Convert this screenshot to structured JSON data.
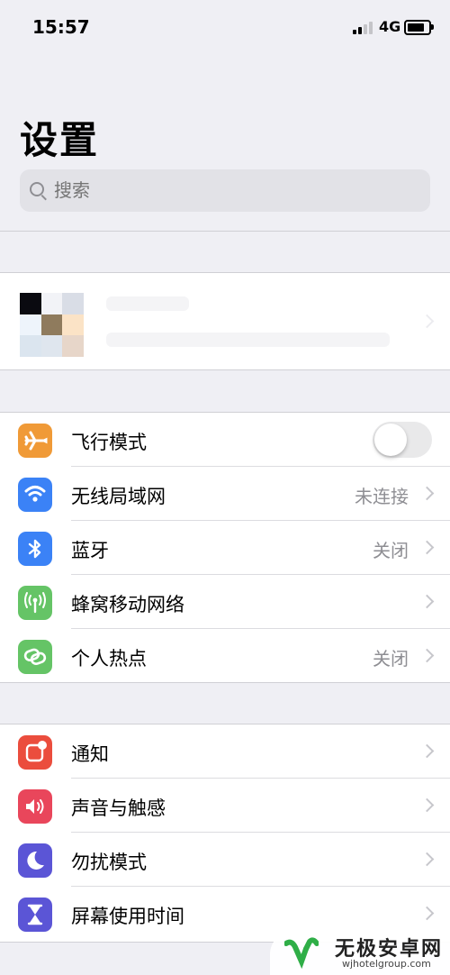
{
  "status_bar": {
    "time": "15:57",
    "network": "4G",
    "battery_level": 0.8
  },
  "page": {
    "title": "设置"
  },
  "search": {
    "placeholder": "搜索"
  },
  "profile": {
    "name": "",
    "subtitle": ""
  },
  "connectivity": [
    {
      "label": "飞行模式",
      "icon": "airplane-icon",
      "color": "#f09a37",
      "toggle": false
    },
    {
      "label": "无线局域网",
      "icon": "wifi-icon",
      "color": "#3b82f6",
      "value": "未连接"
    },
    {
      "label": "蓝牙",
      "icon": "bluetooth-icon",
      "color": "#3b82f6",
      "value": "关闭"
    },
    {
      "label": "蜂窝移动网络",
      "icon": "cellular-icon",
      "color": "#65c466",
      "value": ""
    },
    {
      "label": "个人热点",
      "icon": "hotspot-icon",
      "color": "#65c466",
      "value": "关闭"
    }
  ],
  "general": [
    {
      "label": "通知",
      "icon": "notifications-icon",
      "color": "#eb4d3d"
    },
    {
      "label": "声音与触感",
      "icon": "sound-icon",
      "color": "#e9465b"
    },
    {
      "label": "勿扰模式",
      "icon": "moon-icon",
      "color": "#5b55d6"
    },
    {
      "label": "屏幕使用时间",
      "icon": "hourglass-icon",
      "color": "#5b55d6"
    }
  ],
  "watermark": {
    "title": "无极安卓网",
    "url": "wjhotelgroup.com"
  }
}
